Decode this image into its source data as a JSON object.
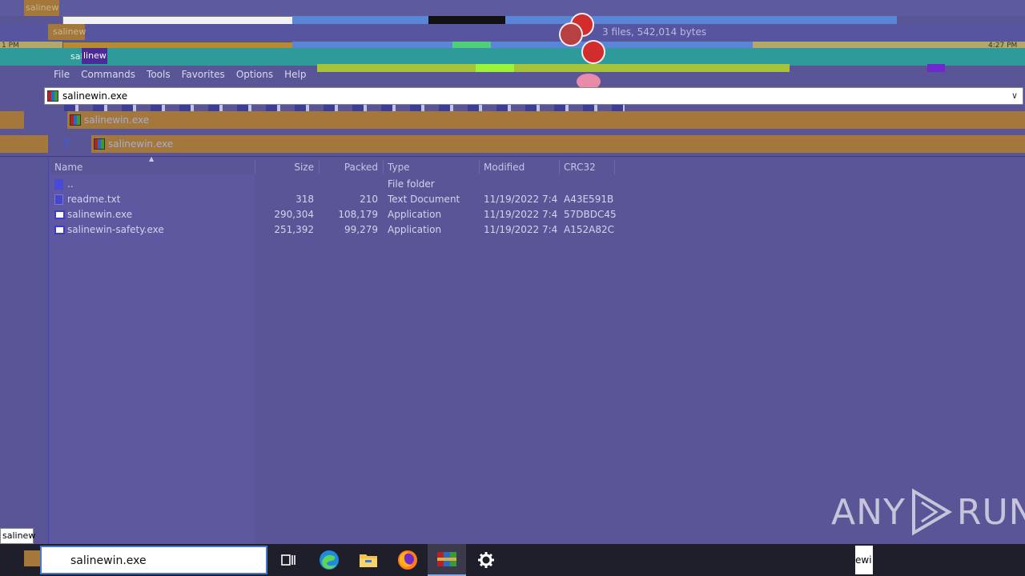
{
  "window": {
    "title_fragments": [
      "salinew",
      "salinew",
      "salinew",
      "linew",
      "ewi"
    ],
    "status_text": "3 files, 542,014 bytes",
    "time_fragment_left": "1 PM",
    "time_fragment_right": "4:27 PM"
  },
  "menu": {
    "items": [
      "File",
      "Commands",
      "Tools",
      "Favorites",
      "Options",
      "Help"
    ]
  },
  "address": {
    "value": "salinewin.exe",
    "breadcrumb_1": "salinewin.exe",
    "breadcrumb_2": "salinewin.exe"
  },
  "columns": [
    "Name",
    "Size",
    "Packed",
    "Type",
    "Modified",
    "CRC32"
  ],
  "files": [
    {
      "name": "..",
      "size": "",
      "packed": "",
      "type": "File folder",
      "modified": "",
      "crc": ""
    },
    {
      "name": "readme.txt",
      "size": "318",
      "packed": "210",
      "type": "Text Document",
      "modified": "11/19/2022 7:4...",
      "crc": "A43E591B"
    },
    {
      "name": "salinewin.exe",
      "size": "290,304",
      "packed": "108,179",
      "type": "Application",
      "modified": "11/19/2022 7:4...",
      "crc": "57DBDC45"
    },
    {
      "name": "salinewin-safety.exe",
      "size": "251,392",
      "packed": "99,279",
      "type": "Application",
      "modified": "11/19/2022 7:4...",
      "crc": "A152A82C"
    }
  ],
  "taskbar": {
    "search_value": "salinewin.exe",
    "tooltip": "salinew",
    "apps": [
      "task-view-icon",
      "edge-icon",
      "file-explorer-icon",
      "firefox-icon",
      "winrar-icon",
      "settings-icon"
    ]
  },
  "watermark": {
    "left": "ANY",
    "right": "RUN"
  },
  "colors": {
    "background": "#5a5596",
    "teal_band": "#2f9a9a",
    "gold_band": "#a3783a",
    "taskbar": "#1f1f2c"
  }
}
